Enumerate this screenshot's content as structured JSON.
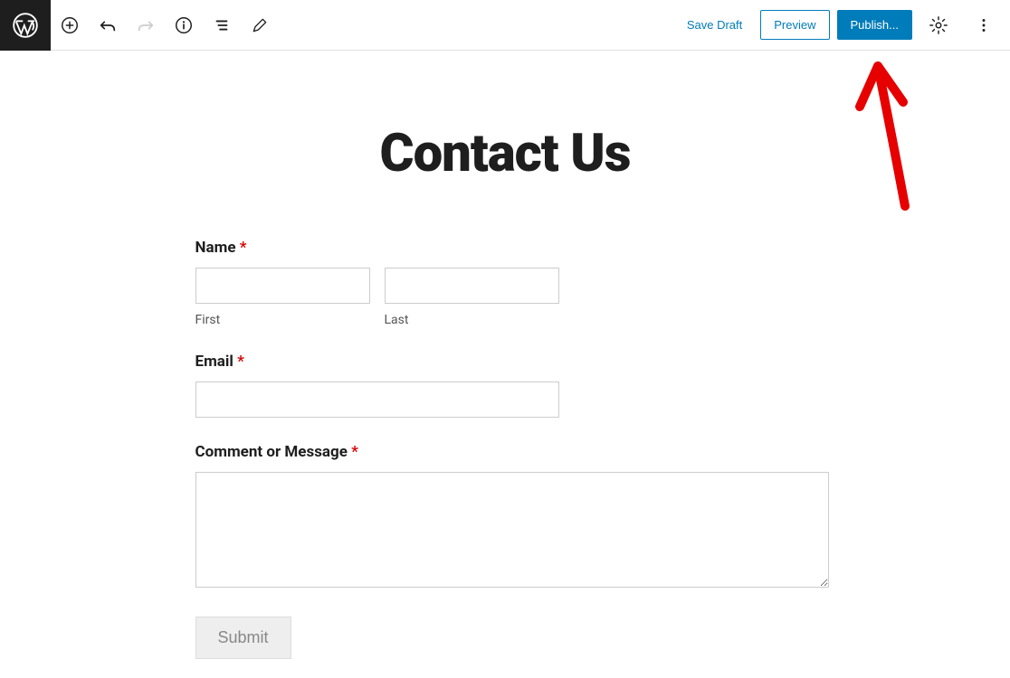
{
  "toolbar": {
    "save_draft": "Save Draft",
    "preview": "Preview",
    "publish": "Publish..."
  },
  "page": {
    "title": "Contact Us"
  },
  "form": {
    "name": {
      "label": "Name",
      "required_marker": "*",
      "first_sublabel": "First",
      "last_sublabel": "Last",
      "first_value": "",
      "last_value": ""
    },
    "email": {
      "label": "Email",
      "required_marker": "*",
      "value": ""
    },
    "message": {
      "label": "Comment or Message",
      "required_marker": "*",
      "value": ""
    },
    "submit_label": "Submit"
  }
}
